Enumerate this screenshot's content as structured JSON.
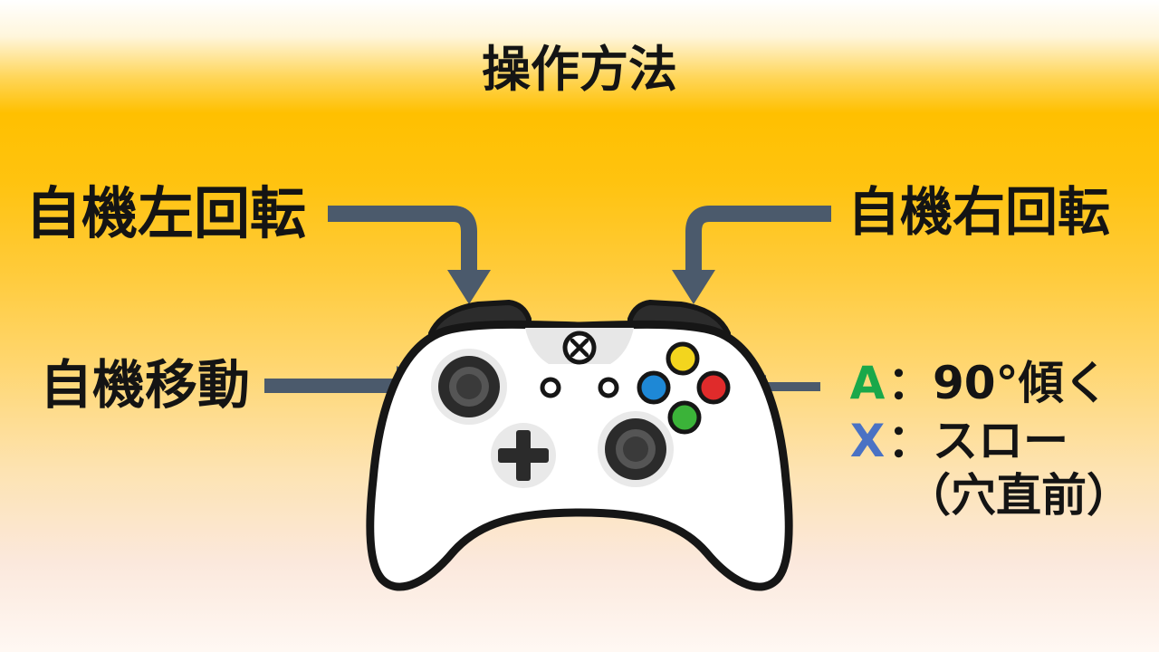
{
  "title": "操作方法",
  "labels": {
    "left_rotate": "自機左回転",
    "right_rotate": "自機右回転",
    "move": "自機移動"
  },
  "buttons": {
    "a_key": "A",
    "a_desc": "：90°傾く",
    "x_key": "X",
    "x_desc": "：スロー",
    "x_note": "（穴直前）"
  },
  "colors": {
    "arrow": "#4b5a6c",
    "a_label": "#1aa84a",
    "x_label": "#4a72c4",
    "btn_yellow": "#f3d51e",
    "btn_blue": "#1e88d6",
    "btn_red": "#e02b2b",
    "btn_green": "#3bb339"
  }
}
